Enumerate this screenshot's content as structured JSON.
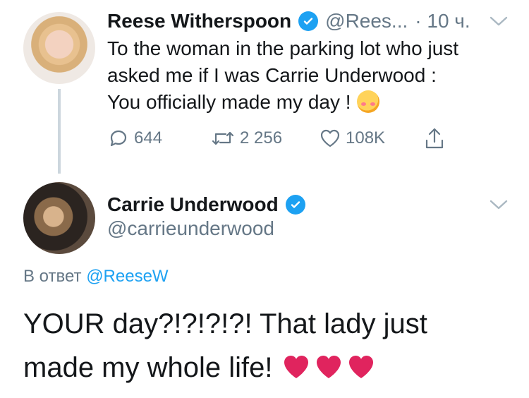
{
  "tweet1": {
    "name": "Reese Witherspoon",
    "handle": "@Rees...",
    "time": "· 10 ч.",
    "text_lines": [
      "To the woman in the parking lot who just",
      "asked me if I was Carrie Underwood :",
      "You officially made my day !"
    ],
    "actions": {
      "replies": "644",
      "retweets": "2 256",
      "likes": "108K"
    }
  },
  "tweet2": {
    "name": "Carrie Underwood",
    "handle": "@carrieunderwood",
    "reply_prefix": "В ответ",
    "reply_target": "@ReeseW",
    "text_lines": [
      "YOUR day?!?!?!?! That lady just",
      "made my whole life!"
    ]
  },
  "colors": {
    "verified": "#1da1f2",
    "link": "#1da1f2",
    "muted": "#657786",
    "text": "#14171a",
    "thread": "#ccd6dd",
    "heart": "#e0245e"
  },
  "icons": [
    "verified-badge-icon",
    "chevron-down-icon",
    "reply-icon",
    "retweet-icon",
    "like-icon",
    "share-icon",
    "smiling-face-with-hearts-icon",
    "red-heart-icon"
  ]
}
